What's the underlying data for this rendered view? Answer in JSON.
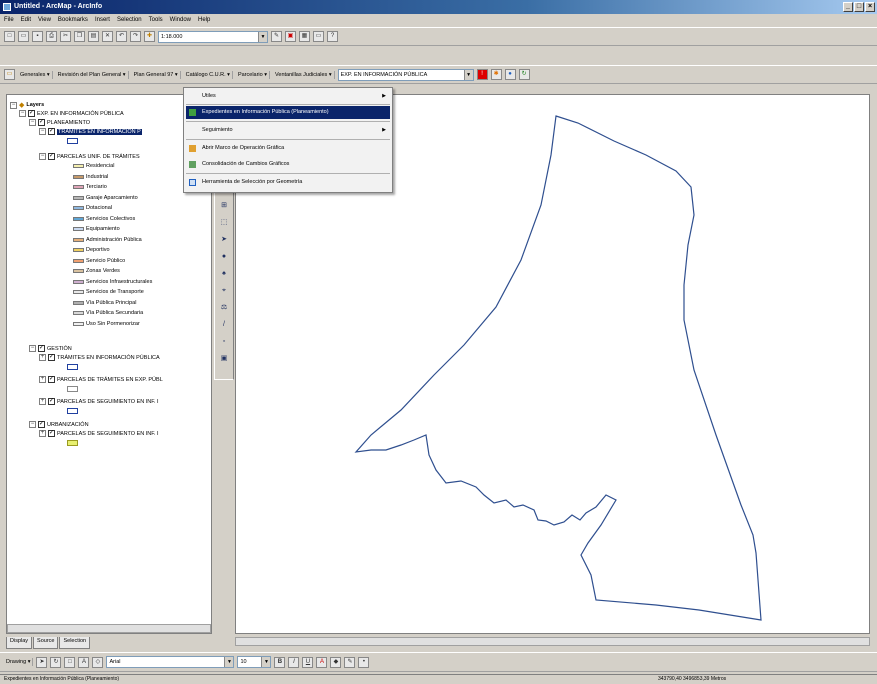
{
  "window": {
    "title": "Untitled - ArcMap - ArcInfo",
    "controls": [
      "_",
      "□",
      "×"
    ]
  },
  "menubar": [
    "File",
    "Edit",
    "View",
    "Bookmarks",
    "Insert",
    "Selection",
    "Tools",
    "Window",
    "Help"
  ],
  "standard_toolbar": {
    "scale_value": "1:18.000"
  },
  "custom_toolbar": {
    "menus": [
      "Generales ▾",
      "Revisión del Plan General ▾",
      "Plan General 97 ▾",
      "Catálogo C.U.R. ▾",
      "Parcelario ▾",
      "Ventanillas Judiciales ▾"
    ],
    "layer_combo": "EXP. EN INFORMACIÓN PÚBLICA"
  },
  "dropdown_menu": {
    "items": [
      {
        "label": "Utiles",
        "submenu": true
      },
      {
        "label": "Expedientes en Información Pública (Planeamiento)",
        "selected": true
      },
      {
        "label": "Seguimiento",
        "submenu": true
      },
      {
        "label": "Abrir Marco de Operación Gráfica"
      },
      {
        "label": "Consolidación de Cambios Gráficos"
      },
      {
        "label": "Herramienta de Selección por Geometría"
      }
    ]
  },
  "toc": {
    "root": "Layers",
    "dataframe": "EXP. EN INFORMACIÓN PÚBLICA",
    "groups": {
      "planeamiento": "PLANEAMIENTO",
      "tramites": "TRÁMITES EN INFORMACIÓN P",
      "parcelas": "PARCELAS UNIF. DE TRÁMITES",
      "gestion": "GESTIÓN",
      "gestion_tramites": "TRÁMITES EN INFORMACIÓN PÚBLICA",
      "gestion_parcelas": "PARCELAS DE TRÁMITES EN EXP. PÚBL",
      "gestion_seguimiento": "PARCELAS DE SEGUIMIENTO EN INF. I",
      "urbanizacion": "URBANIZACIÓN",
      "urb_seguimiento": "PARCELAS DE SEGUIMIENTO EN INF. I"
    },
    "legend": [
      {
        "label": "Residencial",
        "color": "#f5f0b0"
      },
      {
        "label": "Industrial",
        "color": "#c79a6a"
      },
      {
        "label": "Terciario",
        "color": "#e0a5b8"
      },
      {
        "label": "Garaje Aparcamiento",
        "color": "#b8b8b8"
      },
      {
        "label": "Dotacional",
        "color": "#8fb8e0"
      },
      {
        "label": "Servicios Colectivos",
        "color": "#5fa6d6"
      },
      {
        "label": "Equipamiento",
        "color": "#c8d8f0"
      },
      {
        "label": "Administración Pública",
        "color": "#e6b07a"
      },
      {
        "label": "Deportivo",
        "color": "#f0d060"
      },
      {
        "label": "Servicio Público",
        "color": "#f0a070"
      },
      {
        "label": "Zonas Verdes",
        "color": "#d9c2a0"
      },
      {
        "label": "Servicios Infraestructurales",
        "color": "#d0b0d0"
      },
      {
        "label": "Servicios de Transporte",
        "color": "#e8e8e8"
      },
      {
        "label": "Vía Pública Principal",
        "color": "#b0b0b0"
      },
      {
        "label": "Vía Pública Secundaria",
        "color": "#d8d8d8"
      },
      {
        "label": "Uso Sin Pormenorizar",
        "color": "#f0f0f0"
      }
    ],
    "tabs": [
      "Display",
      "Source",
      "Selection"
    ]
  },
  "drawing_toolbar": {
    "label": "Drawing ▾",
    "font": "Arial",
    "size": "10"
  },
  "statusbar": {
    "message": "Expedientes en Información Pública (Planeamiento)",
    "coords": "343790,40 3496853,39 Metros"
  },
  "colors": {
    "title_start": "#0a246a",
    "boundary": "#2f4f8f"
  }
}
